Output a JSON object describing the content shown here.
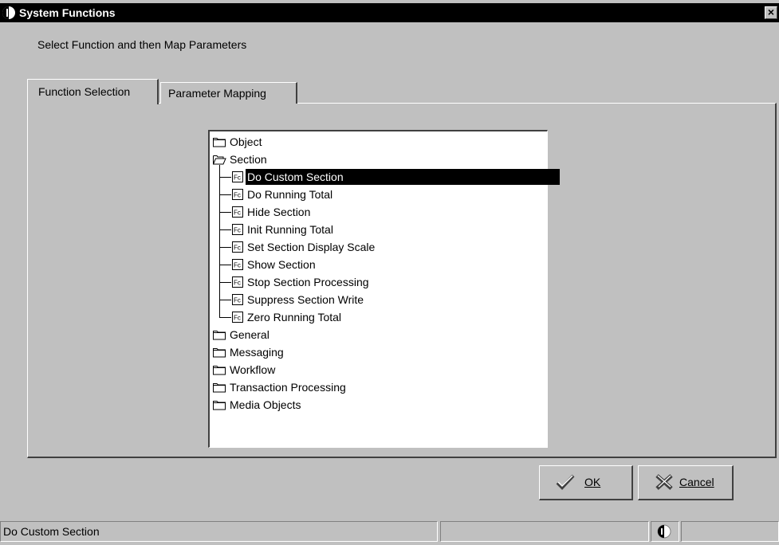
{
  "window": {
    "title": "System Functions",
    "close_label": "×"
  },
  "instruction": "Select Function and then Map Parameters",
  "tabs": [
    {
      "label": "Function Selection",
      "active": true
    },
    {
      "label": "Parameter Mapping",
      "active": false
    }
  ],
  "tree": {
    "folders_before": [
      {
        "label": "Object"
      }
    ],
    "open_folder": {
      "label": "Section"
    },
    "functions": [
      {
        "label": "Do Custom Section",
        "selected": true
      },
      {
        "label": "Do Running Total"
      },
      {
        "label": "Hide Section"
      },
      {
        "label": "Init Running Total"
      },
      {
        "label": "Set Section Display Scale"
      },
      {
        "label": "Show Section"
      },
      {
        "label": "Stop Section Processing"
      },
      {
        "label": "Suppress Section Write"
      },
      {
        "label": "Zero Running Total"
      }
    ],
    "folders_after": [
      {
        "label": "General"
      },
      {
        "label": "Messaging"
      },
      {
        "label": "Workflow"
      },
      {
        "label": "Transaction Processing"
      },
      {
        "label": "Media Objects"
      }
    ],
    "function_icon_text": "Fc"
  },
  "buttons": {
    "ok": {
      "mnemonic": "O",
      "rest": "K",
      "icon": "check-icon"
    },
    "cancel": {
      "mnemonic": "C",
      "rest": "ancel",
      "icon": "x-icon"
    }
  },
  "status": {
    "text": "Do Custom Section",
    "icon": "globe-icon"
  },
  "colors": {
    "selection": "#000000",
    "face": "#c0c0c0",
    "titlebar": "#000000"
  }
}
